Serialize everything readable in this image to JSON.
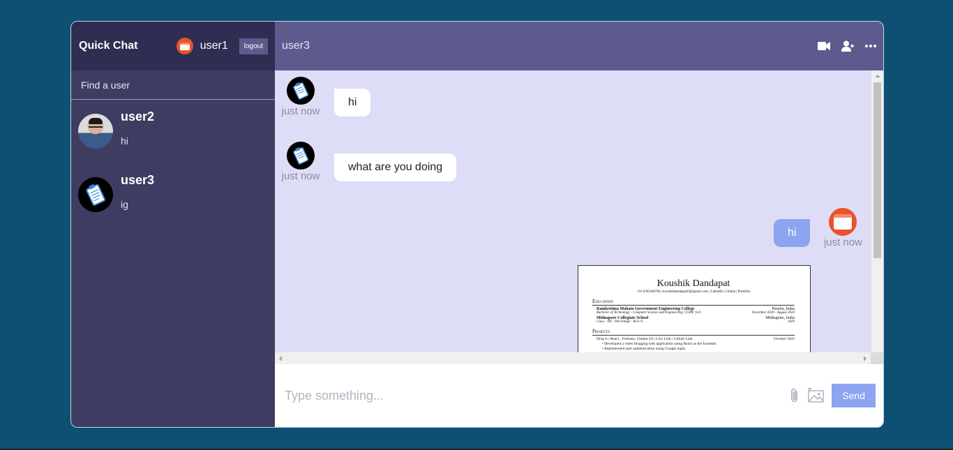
{
  "sidebar": {
    "app_title": "Quick Chat",
    "current_user": "user1",
    "logout_label": "logout",
    "search_placeholder": "Find a user",
    "chats": [
      {
        "name": "user2",
        "last_message": "hi",
        "avatar": "photo-avatar"
      },
      {
        "name": "user3",
        "last_message": "ig",
        "avatar": "clipboard-avatar"
      }
    ]
  },
  "chat": {
    "header_user": "user3",
    "header_icons": [
      "video-camera-icon",
      "add-user-icon",
      "more-icon"
    ],
    "messages": [
      {
        "text": "hi",
        "time": "just now",
        "owner": false
      },
      {
        "text": "what are you doing",
        "time": "just now",
        "owner": false
      },
      {
        "text": "hi",
        "time": "just now",
        "owner": true
      }
    ],
    "attachment": {
      "name": "Koushik Dandapat",
      "contact": "+91 6395446784 | koushikdandapat10@gmail.com | LinkedIn | Github | Portfolio",
      "section_education": "Education",
      "edu1_school": "Ramkrishna Mahato Government Engineering College",
      "edu1_place": "Purulia, India",
      "edu1_degree": "Bachelor of Technology - Computer Science and Engineering; CGPA: 9.31",
      "edu1_dates": "November 2020 - August 2024",
      "edu2_school": "Midnapore Collegiate School",
      "edu2_place": "Midnapore, India",
      "edu2_degree": "Class : XII ; Percentage : 86.6 %",
      "edu2_year": "2020",
      "section_projects": "Projects",
      "proj1_title": "Drop it | React , Firebase, Chakra-UI | Live Link | Github Link",
      "proj1_date": "October 2022",
      "proj1_b1": "• Developed a video blogging web application using React as the frontend.",
      "proj1_b2": "• Implemented user authentication using Google login."
    }
  },
  "composer": {
    "placeholder": "Type something...",
    "send_label": "Send"
  }
}
